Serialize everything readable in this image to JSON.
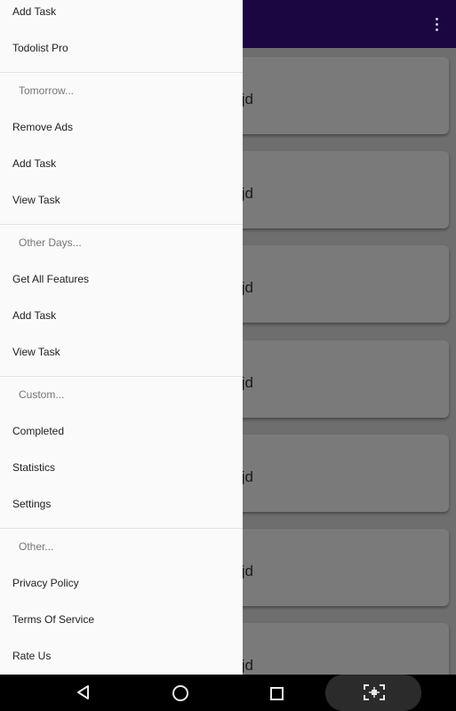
{
  "drawer": {
    "items": [
      {
        "label": "Add Task"
      },
      {
        "label": "Todolist Pro"
      },
      {
        "label": "Remove Ads"
      },
      {
        "label": "Add Task"
      },
      {
        "label": "View Task"
      },
      {
        "label": "Get All Features"
      },
      {
        "label": "Add Task"
      },
      {
        "label": "View Task"
      },
      {
        "label": "Completed"
      },
      {
        "label": "Statistics"
      },
      {
        "label": "Settings"
      },
      {
        "label": "Privacy Policy"
      },
      {
        "label": "Terms Of Service"
      },
      {
        "label": "Rate Us"
      }
    ],
    "sections": [
      {
        "label": "Tomorrow..."
      },
      {
        "label": "Other Days..."
      },
      {
        "label": "Custom..."
      },
      {
        "label": "Other..."
      }
    ]
  },
  "tasks": [
    {
      "text": "ljd"
    },
    {
      "text": "ljd"
    },
    {
      "text": "ljd"
    },
    {
      "text": "ljd"
    },
    {
      "text": "ljd"
    },
    {
      "text": "ljd"
    },
    {
      "text": "ljd"
    }
  ],
  "icons": {
    "overflow": "more-vert-icon",
    "back": "back-triangle-icon",
    "home": "home-circle-icon",
    "recents": "recents-square-icon",
    "screenshot": "screenshot-icon"
  },
  "colors": {
    "appbar": "#1b0642",
    "drawer_bg": "#fafafa",
    "scrim": "#6e6e6e",
    "section_text": "#757575"
  }
}
